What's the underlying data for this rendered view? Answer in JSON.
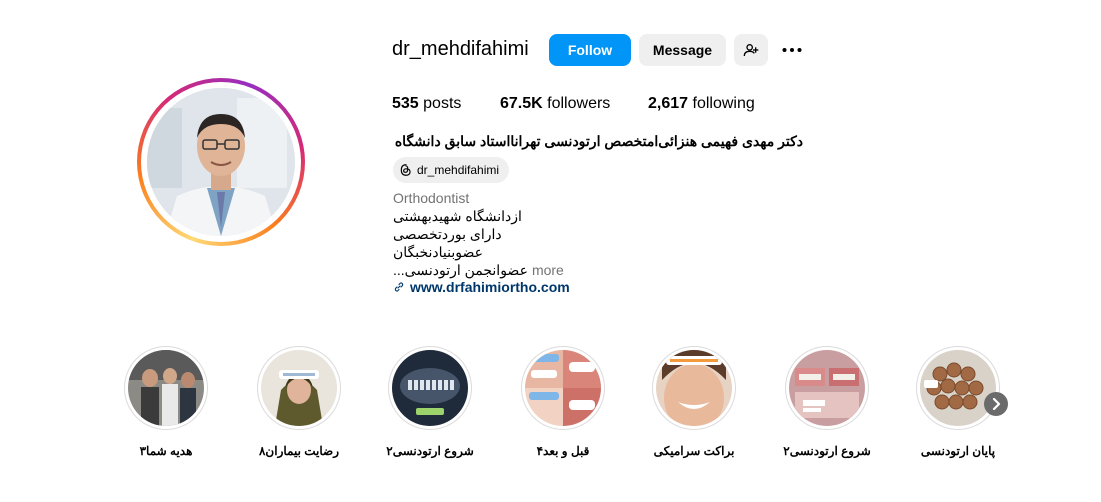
{
  "profile": {
    "username": "dr_mehdifahimi",
    "follow_label": "Follow",
    "message_label": "Message",
    "stats": {
      "posts_count": "535",
      "posts_label": "posts",
      "followers_count": "67.5K",
      "followers_label": "followers",
      "following_count": "2,617",
      "following_label": "following"
    },
    "bio_name": "دکتر مهدی فهیمی هنزائی‌امتخصص ارتودنسی تهرانااستاد سابق دانشگاه",
    "threads_handle": "dr_mehdifahimi",
    "category": "Orthodontist",
    "bio_lines": [
      "ازدانشگاه شهیدبهشتی",
      "دارای بوردتخصصی",
      "عضوبنیادنخبگان",
      "عضوانجمن ارتودنسی..."
    ],
    "more_label": "more",
    "website": "www.drfahimiortho.com"
  },
  "highlights": [
    {
      "label": "هدیه شما۳"
    },
    {
      "label": "رضایت بیماران۸"
    },
    {
      "label": "شروع ارتودنسی۲"
    },
    {
      "label": "قبل و بعد۴"
    },
    {
      "label": "براکت سرامیکی"
    },
    {
      "label": "شروع ارتودنسی۲"
    },
    {
      "label": "پایان ارتودنسی"
    }
  ],
  "colors": {
    "follow_blue": "#0095f6",
    "button_grey": "#efefef",
    "link_blue": "#00376b",
    "muted_text": "#737373"
  },
  "icons": [
    "add-person-icon",
    "more-options-icon",
    "threads-icon",
    "link-icon",
    "chevron-right-icon"
  ]
}
